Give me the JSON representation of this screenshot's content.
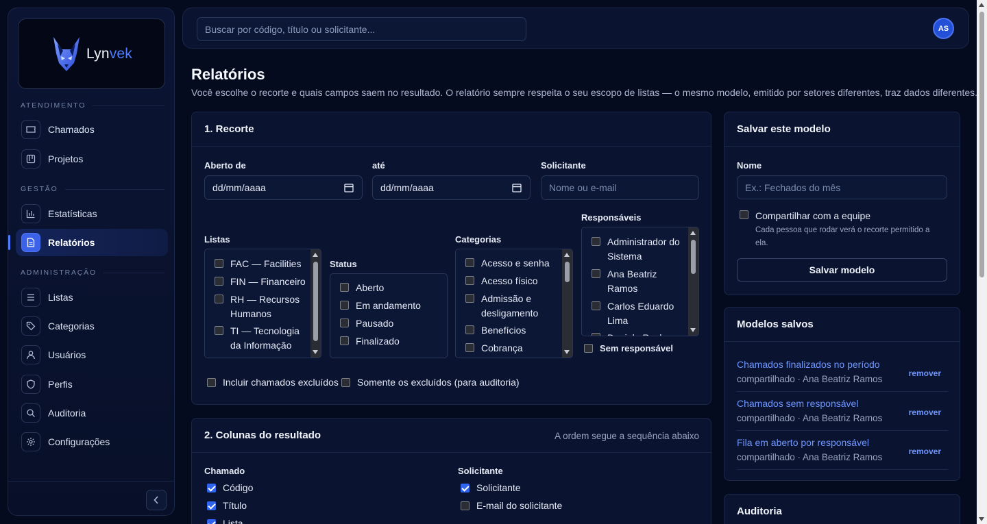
{
  "brand": {
    "name_part1": "Lyn",
    "name_part2": "vek"
  },
  "search": {
    "placeholder": "Buscar por código, título ou solicitante..."
  },
  "user": {
    "initials": "AS"
  },
  "sidebar": {
    "sections": [
      "ATENDIMENTO",
      "GESTÃO",
      "ADMINISTRAÇÃO"
    ],
    "items": [
      {
        "label": "Chamados",
        "icon": "ticket-icon"
      },
      {
        "label": "Projetos",
        "icon": "kanban-icon"
      },
      {
        "label": "Estatísticas",
        "icon": "bar-chart-icon"
      },
      {
        "label": "Relatórios",
        "icon": "report-icon",
        "active": true
      },
      {
        "label": "Listas",
        "icon": "list-icon"
      },
      {
        "label": "Categorias",
        "icon": "tag-icon"
      },
      {
        "label": "Usuários",
        "icon": "user-icon"
      },
      {
        "label": "Perfis",
        "icon": "shield-icon"
      },
      {
        "label": "Auditoria",
        "icon": "search-icon"
      },
      {
        "label": "Configurações",
        "icon": "gear-icon"
      }
    ]
  },
  "page": {
    "title": "Relatórios",
    "subtitle": "Você escolhe o recorte e quais campos saem no resultado. O relatório sempre respeita o seu escopo de listas — o mesmo modelo, emitido por setores diferentes, traz dados diferentes."
  },
  "recorte": {
    "title": "1. Recorte",
    "aberto_de_label": "Aberto de",
    "ate_label": "até",
    "date_placeholder": "dd/mm/aaaa",
    "solicitante_label": "Solicitante",
    "solicitante_placeholder": "Nome ou e-mail",
    "listas_label": "Listas",
    "listas": [
      "FAC — Facilities",
      "FIN — Financeiro",
      "RH — Recursos Humanos",
      "TI — Tecnologia da Informação"
    ],
    "status_label": "Status",
    "status": [
      "Aberto",
      "Em andamento",
      "Pausado",
      "Finalizado"
    ],
    "categorias_label": "Categorias",
    "categorias": [
      "Acesso e senha",
      "Acesso físico",
      "Admissão e desligamento",
      "Benefícios",
      "Cobrança"
    ],
    "responsaveis_label": "Responsáveis",
    "responsaveis": [
      "Administrador do Sistema",
      "Ana Beatriz Ramos",
      "Carlos Eduardo Lima",
      "Daniela Rocha"
    ],
    "sem_responsavel": "Sem responsável",
    "incluir_excluidos": "Incluir chamados excluídos",
    "somente_excluidos": "Somente os excluídos (para auditoria)"
  },
  "colunas": {
    "title": "2. Colunas do resultado",
    "hint": "A ordem segue a sequência abaixo",
    "chamado_label": "Chamado",
    "chamado": [
      {
        "label": "Código",
        "checked": true
      },
      {
        "label": "Título",
        "checked": true
      },
      {
        "label": "Lista",
        "checked": true
      }
    ],
    "solicitante_label": "Solicitante",
    "solicitante": [
      {
        "label": "Solicitante",
        "checked": true
      },
      {
        "label": "E-mail do solicitante",
        "checked": false
      }
    ]
  },
  "salvar": {
    "title": "Salvar este modelo",
    "nome_label": "Nome",
    "nome_placeholder": "Ex.: Fechados do mês",
    "compartilhar_label": "Compartilhar com a equipe",
    "compartilhar_help": "Cada pessoa que rodar verá o recorte permitido a ela.",
    "button": "Salvar modelo"
  },
  "modelos": {
    "title": "Modelos salvos",
    "remove_label": "remover",
    "items": [
      {
        "name": "Chamados finalizados no período",
        "meta": "compartilhado · Ana Beatriz Ramos"
      },
      {
        "name": "Chamados sem responsável",
        "meta": "compartilhado · Ana Beatriz Ramos"
      },
      {
        "name": "Fila em aberto por responsável",
        "meta": "compartilhado · Ana Beatriz Ramos"
      }
    ]
  },
  "auditoria": {
    "title": "Auditoria"
  },
  "colors": {
    "accent": "#4f7dff",
    "background": "#050b1f",
    "card": "#0a1430",
    "link": "#6e96ff"
  }
}
